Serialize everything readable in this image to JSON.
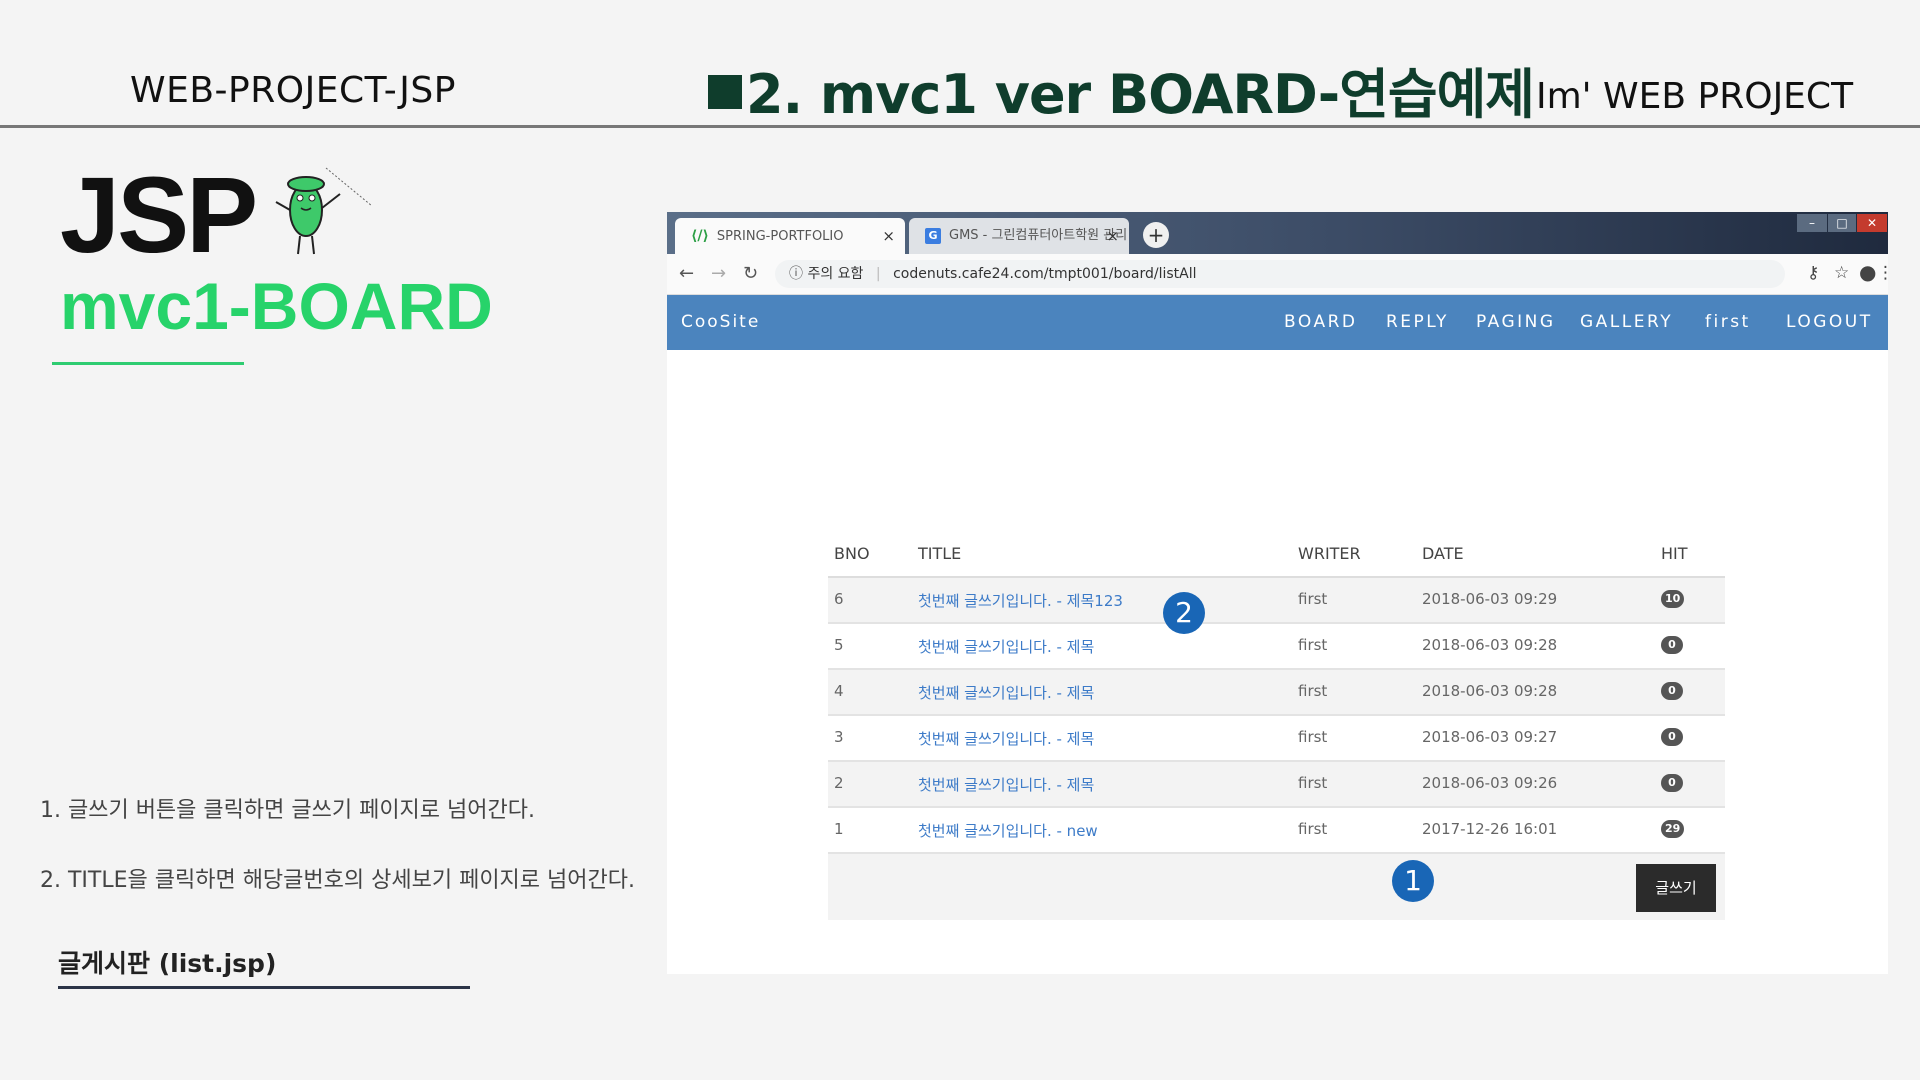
{
  "header": {
    "left": "WEB-PROJECT-JSP",
    "title": "2. mvc1 ver  BOARD-연습예제",
    "right": "Im'  WEB PROJECT"
  },
  "left_panel": {
    "logo": "JSP",
    "subtitle": "mvc1-BOARD",
    "notes": [
      "1. 글쓰기 버튼을 클릭하면 글쓰기 페이지로 넘어간다.",
      "2. TITLE을 클릭하면 해당글번호의 상세보기 페이지로 넘어간다."
    ],
    "page_label": "글게시판   (list.jsp)"
  },
  "browser": {
    "tabs": [
      {
        "icon": "code-icon",
        "label": "SPRING-PORTFOLIO"
      },
      {
        "icon": "g-icon",
        "label": "GMS - 그린컴퓨터아트학원 관리"
      }
    ],
    "address": {
      "security": "주의 요함",
      "url": "codenuts.cafe24.com/tmpt001/board/listAll"
    },
    "site": {
      "brand": "CooSite",
      "menu": [
        "BOARD",
        "REPLY",
        "PAGING",
        "GALLERY",
        "first",
        "LOGOUT"
      ]
    },
    "table": {
      "columns": [
        "BNO",
        "TITLE",
        "WRITER",
        "DATE",
        "HIT"
      ],
      "rows": [
        {
          "bno": "6",
          "title": "첫번째 글쓰기입니다. - 제목123",
          "writer": "first",
          "date": "2018-06-03 09:29",
          "hit": "10"
        },
        {
          "bno": "5",
          "title": "첫번째 글쓰기입니다. - 제목",
          "writer": "first",
          "date": "2018-06-03 09:28",
          "hit": "0"
        },
        {
          "bno": "4",
          "title": "첫번째 글쓰기입니다. - 제목",
          "writer": "first",
          "date": "2018-06-03 09:28",
          "hit": "0"
        },
        {
          "bno": "3",
          "title": "첫번째 글쓰기입니다. - 제목",
          "writer": "first",
          "date": "2018-06-03 09:27",
          "hit": "0"
        },
        {
          "bno": "2",
          "title": "첫번째 글쓰기입니다. - 제목",
          "writer": "first",
          "date": "2018-06-03 09:26",
          "hit": "0"
        },
        {
          "bno": "1",
          "title": "첫번째 글쓰기입니다. - new",
          "writer": "first",
          "date": "2017-12-26 16:01",
          "hit": "29"
        }
      ]
    },
    "write_button": "글쓰기"
  },
  "callouts": [
    "1",
    "2"
  ],
  "colors": {
    "title": "#0f3d2c",
    "accent_green": "#27d36a",
    "site_nav": "#4b84be",
    "link": "#3d7bc8",
    "callout": "#1966b6"
  }
}
